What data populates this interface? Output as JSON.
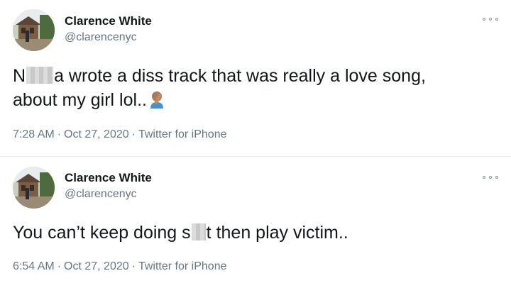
{
  "tweets": [
    {
      "author_name": "Clarence White",
      "author_handle": "@clarencenyc",
      "text_part1": "N",
      "text_part2": "a wrote a diss track that was really a love song,",
      "text_line2": "about my girl lol..",
      "emoji_icon": "facepalm-emoji",
      "time": "7:28 AM",
      "date": "Oct 27, 2020",
      "source": "Twitter for iPhone"
    },
    {
      "author_name": "Clarence White",
      "author_handle": "@clarencenyc",
      "text_part1": "You can’t keep doing s",
      "text_part2": "t then play victim..",
      "time": "6:54 AM",
      "date": "Oct 27, 2020",
      "source": "Twitter for iPhone"
    }
  ],
  "separator": "·",
  "colors": {
    "name": "#14171a",
    "secondary": "#657786",
    "divider": "#e6ecf0"
  }
}
